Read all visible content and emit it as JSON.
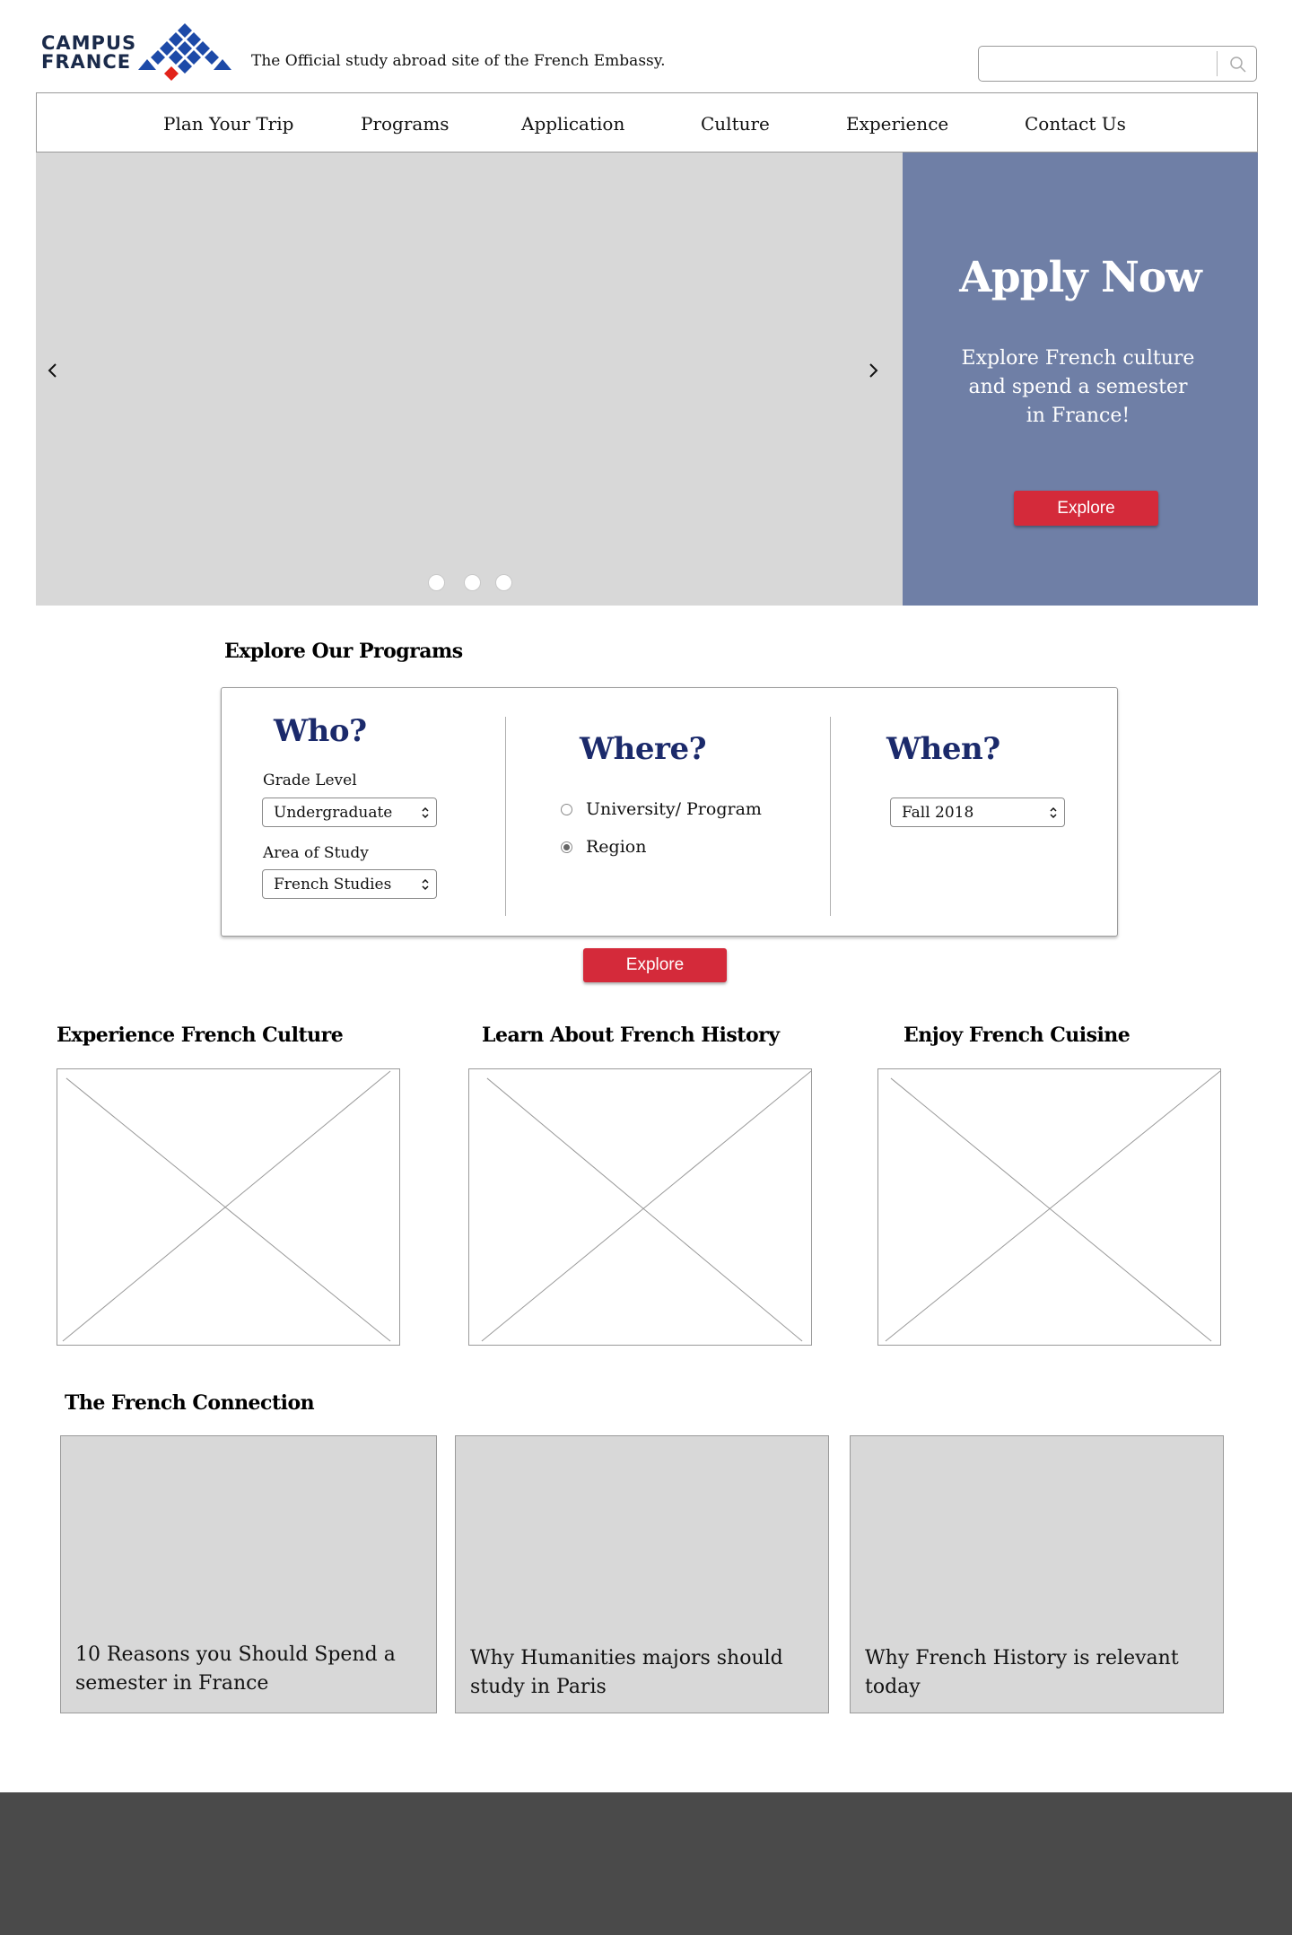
{
  "header": {
    "logo_line1": "CAMPUS",
    "logo_line2": "FRANCE",
    "tagline": "The Official study abroad site of the French Embassy.",
    "search_placeholder": "",
    "search_icon": "search-icon"
  },
  "nav": {
    "items": [
      {
        "label": "Plan Your Trip"
      },
      {
        "label": "Programs"
      },
      {
        "label": "Application"
      },
      {
        "label": "Culture"
      },
      {
        "label": "Experience"
      },
      {
        "label": "Contact Us"
      }
    ]
  },
  "hero": {
    "prev_icon": "chevron-left-icon",
    "next_icon": "chevron-right-icon",
    "slide_count": 3,
    "apply": {
      "title": "Apply Now",
      "text": "Explore French culture and spend a semester in France!",
      "button_label": "Explore"
    },
    "colors": {
      "slide_bg": "#d8d8d8",
      "panel_bg": "#6f7fa6",
      "button_bg": "#d42a3a"
    }
  },
  "programs": {
    "title": "Explore Our Programs",
    "who": {
      "heading": "Who?",
      "grade_label": "Grade Level",
      "grade_value": "Undergraduate",
      "area_label": "Area of Study",
      "area_value": "French Studies"
    },
    "where": {
      "heading": "Where?",
      "options": [
        {
          "label": "University/ Program",
          "checked": false
        },
        {
          "label": "Region",
          "checked": true
        }
      ]
    },
    "when": {
      "heading": "When?",
      "value": "Fall 2018"
    },
    "button_label": "Explore",
    "heading_color": "#1b2a6b"
  },
  "features": {
    "items": [
      {
        "title": "Experience French Culture"
      },
      {
        "title": "Learn About French History"
      },
      {
        "title": "Enjoy French Cuisine"
      }
    ]
  },
  "connection": {
    "title": "The French Connection",
    "articles": [
      {
        "title": "10 Reasons you Should Spend a semester in France"
      },
      {
        "title": "Why Humanities majors should study in Paris"
      },
      {
        "title": "Why French History is relevant today"
      }
    ]
  },
  "footer": {
    "bg": "#4a4a4a"
  }
}
